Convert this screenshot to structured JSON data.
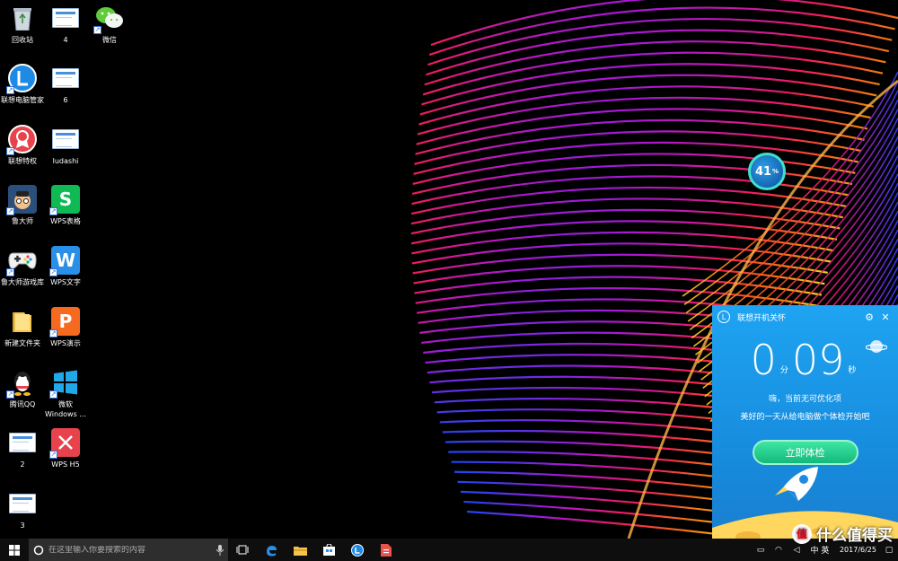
{
  "desktop": {
    "icons": [
      {
        "label": "回收站",
        "icon": "recycle-bin-icon"
      },
      {
        "label": "4",
        "icon": "document-icon"
      },
      {
        "label": "微信",
        "icon": "wechat-icon"
      },
      {
        "label": "联想电脑管家",
        "icon": "lenovo-manager-icon"
      },
      {
        "label": "6",
        "icon": "document-icon"
      },
      {
        "label": "联想特权",
        "icon": "lenovo-privilege-icon"
      },
      {
        "label": "ludashi",
        "icon": "document-icon"
      },
      {
        "label": "鲁大师",
        "icon": "ludashi-icon"
      },
      {
        "label": "WPS表格",
        "icon": "wps-spreadsheet-icon"
      },
      {
        "label": "鲁大师游戏库",
        "icon": "gamepad-icon"
      },
      {
        "label": "WPS文字",
        "icon": "wps-writer-icon"
      },
      {
        "label": "新建文件夹",
        "icon": "folder-icon"
      },
      {
        "label": "WPS演示",
        "icon": "wps-presentation-icon"
      },
      {
        "label": "腾讯QQ",
        "icon": "qq-icon"
      },
      {
        "label": "微软",
        "label2": "Windows ...",
        "icon": "windows-icon"
      },
      {
        "label": "2",
        "icon": "document-icon"
      },
      {
        "label": "WPS H5",
        "icon": "wps-h5-icon"
      },
      {
        "label": "3",
        "icon": "document-icon"
      }
    ],
    "colors": {
      "wps_green": "#0fb954",
      "wps_blue": "#2a8fe6",
      "wps_orange": "#f56a1e",
      "wps_red": "#e8434c",
      "lenovo_blue": "#1f8ae3"
    }
  },
  "widget": {
    "percent": "41",
    "percent_unit": "%"
  },
  "panel": {
    "title": "联想开机关怀",
    "logo": "L",
    "settings_icon": "⚙",
    "close_icon": "✕",
    "minutes": "0",
    "minutes_unit": "分",
    "seconds": "09",
    "seconds_unit": "秒",
    "line1": "嗨，当前无可优化项",
    "line2": "美好的一天从给电脑做个体检开始吧",
    "button_label": "立即体检",
    "colors": {
      "background": "#1ea4f2",
      "button": "#13b97a"
    }
  },
  "taskbar": {
    "search_placeholder": "在这里输入你要搜索的内容",
    "clock_date": "2017/6/25",
    "tray_text": "中 英"
  },
  "watermark": {
    "text": "什么值得买",
    "badge": "值"
  }
}
